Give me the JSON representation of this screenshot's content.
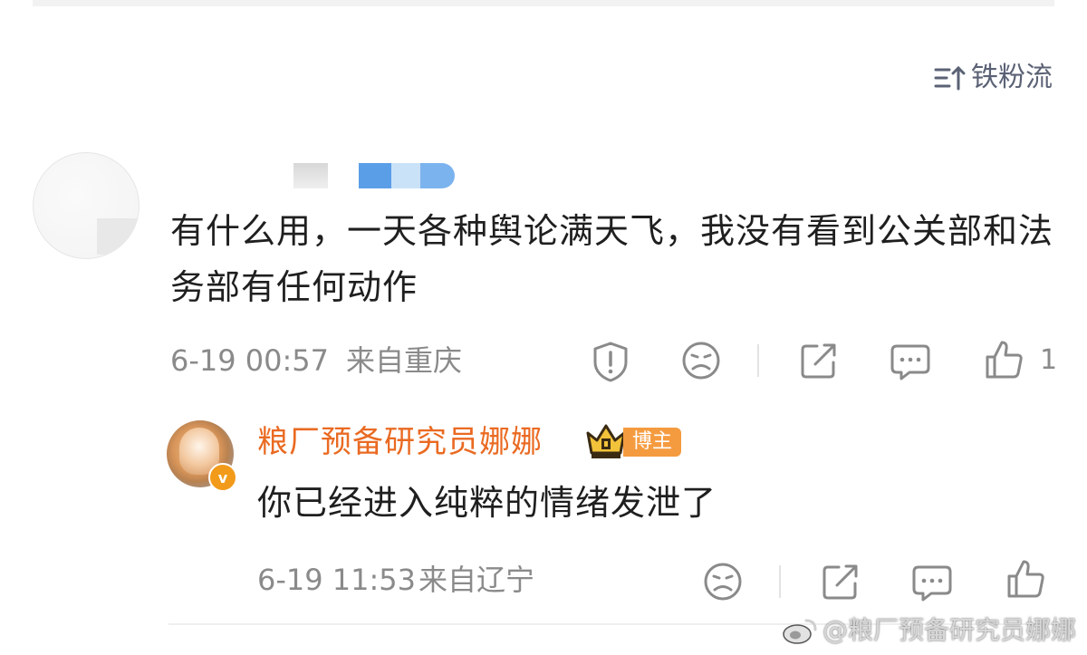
{
  "sort": {
    "label": "铁粉流",
    "icon": "sort-icon"
  },
  "comment": {
    "text": "有什么用，一天各种舆论满天飞，我没有看到公关部和法务部有任何动作",
    "time": "6-19 00:57",
    "location": "来自重庆",
    "like_count": "1",
    "actions": [
      "report-icon",
      "dislike-face-icon",
      "share-icon",
      "comment-icon",
      "like-icon"
    ]
  },
  "reply": {
    "author": "粮厂预备研究员娜娜",
    "badge": "博主",
    "verified": "v",
    "text": "你已经进入纯粹的情绪发泄了",
    "time": "6-19 11:53",
    "location": "来自辽宁",
    "actions": [
      "dislike-face-icon",
      "share-icon",
      "comment-icon",
      "like-icon"
    ]
  },
  "watermark": "@粮厂预备研究员娜娜",
  "colors": {
    "author_orange": "#ea6a22",
    "meta_gray": "#8a8a8a",
    "badge_orange": "#f59b3f"
  }
}
